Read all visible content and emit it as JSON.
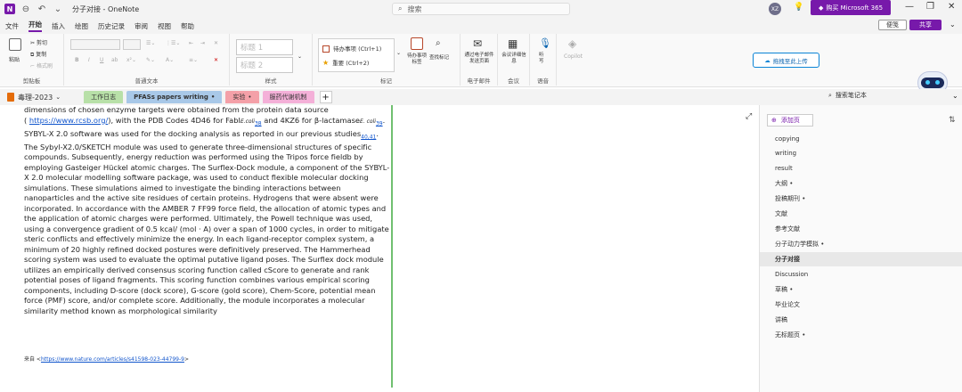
{
  "titlebar": {
    "title": "分子对接 - OneNote",
    "search_placeholder": "搜索",
    "avatar": "XZ",
    "buy_label": "购买 Microsoft 365",
    "app_color": "#7719aa",
    "buy_color": "#7719aa",
    "avatar_color": "#6e6e8a"
  },
  "menu": {
    "items": [
      "文件",
      "开始",
      "插入",
      "绘图",
      "历史记录",
      "审阅",
      "视图",
      "帮助"
    ],
    "sticky_label": "便笺",
    "share_label": "共享"
  },
  "ribbon": {
    "clipboard": {
      "paste": "粘贴",
      "cut": "剪切",
      "copy": "复制",
      "format_painter": "格式刷",
      "label": "剪贴板"
    },
    "text": {
      "label": "普通文本"
    },
    "styles": {
      "h1": "标题 1",
      "h2": "标题 2",
      "label": "样式"
    },
    "tags": {
      "todo": "待办事项 (Ctrl+1)",
      "important": "重要 (Ctrl+2)",
      "todo_btn": "待办事项标签",
      "find_tags": "查找标记",
      "label": "标记"
    },
    "email": {
      "btn": "通过电子邮件发送页面",
      "label": "电子邮件"
    },
    "meeting": {
      "btn": "会议详细信息",
      "label": "会议"
    },
    "voice": {
      "btn": "听写",
      "label": "语音"
    },
    "copilot": {
      "btn": "Copilot"
    },
    "upload_label": "拖拽至此上传"
  },
  "notebook": {
    "name": "毒理-2023",
    "sections": [
      {
        "label": "工作日志",
        "color": "#b8e0a8"
      },
      {
        "label": "PFASs papers writing",
        "color": "#a8c8e8"
      },
      {
        "label": "实验",
        "color": "#f4a0a8"
      },
      {
        "label": "服药代谢机制",
        "color": "#f4b0d8"
      }
    ],
    "search_label": "搜索笔记本"
  },
  "note": {
    "l1": "dimensions of chosen enzyme targets were obtained from the protein data source",
    "l2a": "( ",
    "l2link": "https://www.rcsb.org/",
    "l2b": "), with the PDB Codes 4D46 for FabI",
    "l2c": "E.coli",
    "l2r1": "38",
    "l2d": " and 4KZ6 for β-lactamase",
    "l2e": "E. coli",
    "l2r2": "39",
    "l2f": ".",
    "l3a": "SYBYL-X 2.0 software was used for the docking analysis as reported in our previous studies",
    "l3r": "40,41",
    "l3b": ".",
    "body1": "The Sybyl-X2.0/SKETCH module was used to generate three-dimensional structures of specific compounds. Subsequently, energy reduction was performed using the Tripos force fieldb by employing Gasteiger Hückel atomic charges. The Surflex-Dock module, a component of the SYBYL-X 2.0 molecular modelling software package, was used to conduct flexible molecular docking simulations. These simulations aimed to investigate the binding interactions between nanoparticles and the active site residues of certain proteins. Hydrogens that were absent were incorporated. In accordance with the AMBER 7 FF99 force field, the allocation of atomic types and the application of atomic charges were performed. Ultimately, the Powell technique was used, using a convergence gradient of 0.5 kcal/ (mol · A) over a span of 1000 cycles, in order to mitigate steric conflicts and effectively minimize the energy. In each ligand-receptor complex system, a minimum of 20 highly refined docked postures were definitively preserved. The Hammerhead scoring system was used to evaluate the optimal putative ligand poses. The Surflex dock module utilizes an empirically derived consensus scoring function called cScore to generate and rank potential poses of ligand fragments. This scoring function combines various empirical scoring components, including D-score (dock score), G-score (gold score), Chem-Score, potential mean force (PMF) score, and/or complete score. Additionally, the module incorporates a molecular similarity method known as morphological similarity",
    "source_prefix": "来自 <",
    "source_link": "https://www.nature.com/articles/s41598-023-44799-9",
    "source_suffix": ">"
  },
  "pages": {
    "add_label": "添加页",
    "items": [
      "copying",
      "writing",
      "result",
      "大纲 •",
      "投稿期刊 •",
      "文献",
      "参考文献",
      "分子动力学模拟 •",
      "分子对接",
      "Discussion",
      "草稿 •",
      "毕业论文",
      "讲稿",
      "无标题页 •"
    ],
    "active_index": 8
  }
}
